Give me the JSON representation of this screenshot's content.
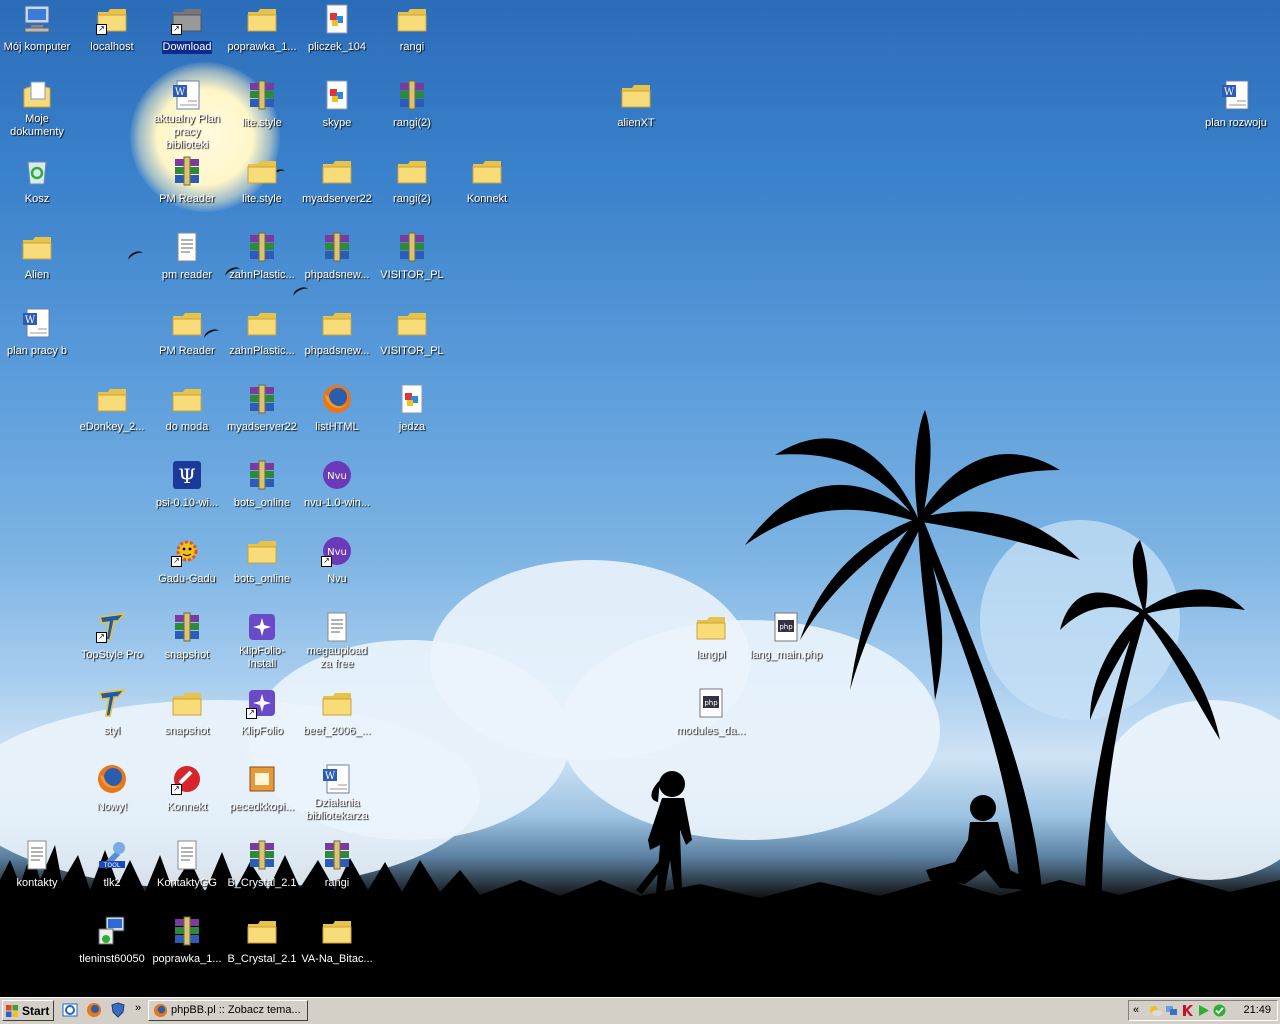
{
  "desktop": {
    "icons": [
      {
        "label": "Mój komputer",
        "type": "computer"
      },
      {
        "label": "localhost",
        "type": "folder",
        "shortcut": true
      },
      {
        "label": "Download",
        "type": "folder-gray",
        "shortcut": true,
        "selected": true
      },
      {
        "label": "poprawka_1...",
        "type": "folder"
      },
      {
        "label": "pliczek_104",
        "type": "image"
      },
      {
        "label": "rangi",
        "type": "folder"
      },
      {
        "label": "Moje dokumenty",
        "type": "mydocs"
      },
      {
        "label": "aktualny Plan pracy biblioteki",
        "type": "word"
      },
      {
        "label": "lite.style",
        "type": "rar"
      },
      {
        "label": "skype",
        "type": "image"
      },
      {
        "label": "rangi(2)",
        "type": "rar"
      },
      {
        "label": "alienXT",
        "type": "folder"
      },
      {
        "label": "plan rozwoju",
        "type": "word"
      },
      {
        "label": "Kosz",
        "type": "recycle"
      },
      {
        "label": "PM Reader",
        "type": "rar"
      },
      {
        "label": "lite.style",
        "type": "folder"
      },
      {
        "label": "myadserver22",
        "type": "folder"
      },
      {
        "label": "rangi(2)",
        "type": "folder"
      },
      {
        "label": "Konnekt",
        "type": "folder"
      },
      {
        "label": "Alien",
        "type": "folder"
      },
      {
        "label": "pm reader",
        "type": "text"
      },
      {
        "label": "zahnPlastic...",
        "type": "rar"
      },
      {
        "label": "phpadsnew...",
        "type": "rar"
      },
      {
        "label": "VISITOR_PL",
        "type": "rar"
      },
      {
        "label": "plan pracy b",
        "type": "word"
      },
      {
        "label": "PM Reader",
        "type": "folder"
      },
      {
        "label": "zahnPlastic...",
        "type": "folder"
      },
      {
        "label": "phpadsnew...",
        "type": "folder"
      },
      {
        "label": "VISITOR_PL",
        "type": "folder"
      },
      {
        "label": "eDonkey_2...",
        "type": "folder"
      },
      {
        "label": "do moda",
        "type": "folder"
      },
      {
        "label": "myadserver22",
        "type": "rar"
      },
      {
        "label": "listHTML",
        "type": "firefox"
      },
      {
        "label": "jedza",
        "type": "image"
      },
      {
        "label": "psi-0.10-wi...",
        "type": "psi"
      },
      {
        "label": "bots_online",
        "type": "rar"
      },
      {
        "label": "nvu-1.0-win...",
        "type": "nvu"
      },
      {
        "label": "Gadu-Gadu",
        "type": "gg",
        "shortcut": true
      },
      {
        "label": "bots_online",
        "type": "folder"
      },
      {
        "label": "Nvu",
        "type": "nvu",
        "shortcut": true
      },
      {
        "label": "TopStyle Pro",
        "type": "topstyle",
        "shortcut": true
      },
      {
        "label": "snapshot",
        "type": "rar"
      },
      {
        "label": "KlipFolio-Install",
        "type": "klip"
      },
      {
        "label": "megaupload za free",
        "type": "text"
      },
      {
        "label": "langpl",
        "type": "folder"
      },
      {
        "label": "lang_main.php",
        "type": "php"
      },
      {
        "label": "styl",
        "type": "topstyle"
      },
      {
        "label": "snapshot",
        "type": "folder"
      },
      {
        "label": "KlipFolio",
        "type": "klip",
        "shortcut": true
      },
      {
        "label": "beef_2006_...",
        "type": "folder"
      },
      {
        "label": "modules_da...",
        "type": "php"
      },
      {
        "label": "Nowy!",
        "type": "firefox"
      },
      {
        "label": "Konnekt",
        "type": "konnekt",
        "shortcut": true
      },
      {
        "label": "pecedkkopi...",
        "type": "installer"
      },
      {
        "label": "Działania bibliotekarza",
        "type": "word"
      },
      {
        "label": "kontakty",
        "type": "text"
      },
      {
        "label": "tlk2",
        "type": "tool"
      },
      {
        "label": "KontaktyGG",
        "type": "text"
      },
      {
        "label": "B_Crystal_2.1",
        "type": "rar"
      },
      {
        "label": "rangi",
        "type": "rar"
      },
      {
        "label": "tleninst60050",
        "type": "setup"
      },
      {
        "label": "poprawka_1...",
        "type": "rar"
      },
      {
        "label": "B_Crystal_2.1",
        "type": "folder"
      },
      {
        "label": "VA-Na_Bitac...",
        "type": "folder"
      }
    ]
  },
  "taskbar": {
    "start_label": "Start",
    "quick_launch": [
      "ie-icon",
      "firefox-icon",
      "shield-icon"
    ],
    "chevron": "»",
    "task_label": "phpBB.pl :: Zobacz tema...",
    "tray_chevron": "«",
    "clock": "21:49"
  },
  "colors": {
    "folder": "#f5d66a",
    "taskbar": "#d4d0c8",
    "selection": "#0b2a8c"
  }
}
